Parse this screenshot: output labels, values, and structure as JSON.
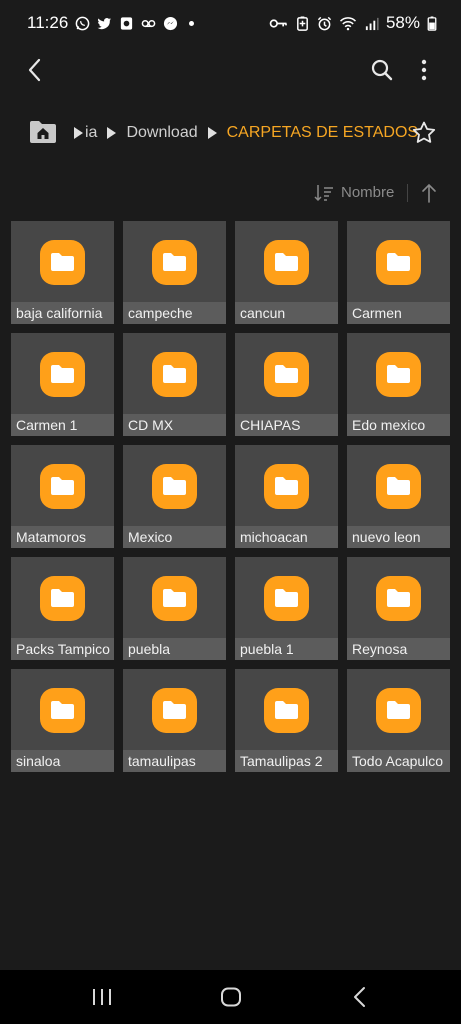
{
  "status_bar": {
    "time": "11:26",
    "battery": "58%"
  },
  "breadcrumb": {
    "items": [
      "ia",
      "Download",
      "CARPETAS DE ESTADOS"
    ]
  },
  "sort": {
    "label": "Nombre"
  },
  "folders": [
    "baja california",
    "campeche",
    "cancun",
    "Carmen",
    "Carmen 1",
    "CD MX",
    "CHIAPAS",
    "Edo mexico",
    "Matamoros",
    "Mexico",
    "michoacan",
    "nuevo leon",
    "Packs Tampico",
    "puebla",
    "puebla 1",
    "Reynosa",
    "sinaloa",
    "tamaulipas",
    "Tamaulipas 2",
    "Todo Acapulco"
  ],
  "colors": {
    "accent": "#f6a623",
    "folder": "#ffa019",
    "tile_bg": "#474747",
    "tile_label_bg": "#5c5c5c",
    "background": "#1b1b1b"
  },
  "icons": {
    "status_left": [
      "whatsapp-icon",
      "twitter-icon",
      "app-icon",
      "voicemail-icon",
      "messenger-icon"
    ],
    "status_right": [
      "vpn-key-icon",
      "battery-saver-icon",
      "alarm-icon",
      "wifi-icon",
      "signal-icon",
      "battery-icon"
    ],
    "toolbar": [
      "back-arrow-icon",
      "search-icon",
      "more-vert-icon"
    ],
    "breadcrumb": [
      "home-folder-icon",
      "star-icon"
    ],
    "folder": "folder-icon"
  }
}
